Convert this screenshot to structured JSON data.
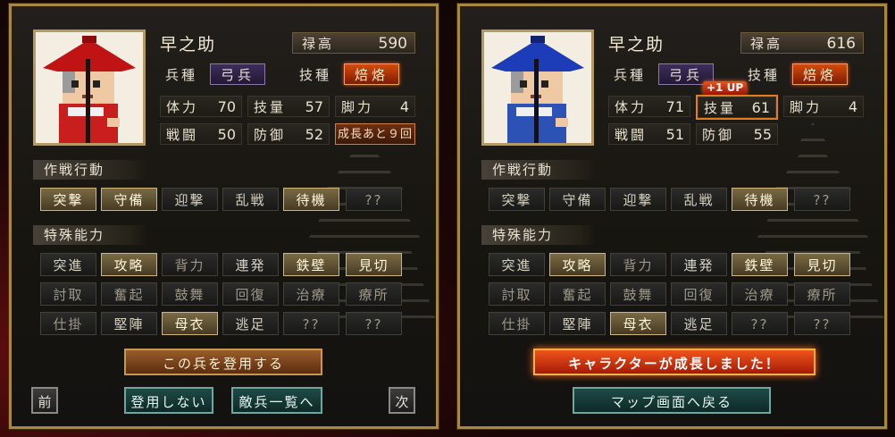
{
  "left": {
    "name": "早之助",
    "rokudaka_label": "禄高",
    "rokudaka_value": "590",
    "unit_label": "兵種",
    "unit_value": "弓兵",
    "skill_label": "技種",
    "skill_value": "焙烙",
    "stats": [
      {
        "label": "体力",
        "value": "70"
      },
      {
        "label": "技量",
        "value": "57"
      },
      {
        "label": "脚力",
        "value": "4"
      },
      {
        "label": "戦闘",
        "value": "50"
      },
      {
        "label": "防御",
        "value": "52"
      }
    ],
    "growth_text": "成長あと９回",
    "action_title": "作戦行動",
    "actions": [
      {
        "label": "突撃",
        "state": "on"
      },
      {
        "label": "守備",
        "state": "on"
      },
      {
        "label": "迎撃",
        "state": "normal"
      },
      {
        "label": "乱戦",
        "state": "normal"
      },
      {
        "label": "待機",
        "state": "on"
      },
      {
        "label": "??",
        "state": "off"
      }
    ],
    "ability_title": "特殊能力",
    "abilities": [
      {
        "label": "突進",
        "state": "normal"
      },
      {
        "label": "攻略",
        "state": "on"
      },
      {
        "label": "背力",
        "state": "off"
      },
      {
        "label": "連発",
        "state": "normal"
      },
      {
        "label": "鉄壁",
        "state": "on"
      },
      {
        "label": "見切",
        "state": "on"
      },
      {
        "label": "討取",
        "state": "off"
      },
      {
        "label": "奮起",
        "state": "off"
      },
      {
        "label": "鼓舞",
        "state": "off"
      },
      {
        "label": "回復",
        "state": "off"
      },
      {
        "label": "治療",
        "state": "off"
      },
      {
        "label": "療所",
        "state": "off"
      },
      {
        "label": "仕掛",
        "state": "off"
      },
      {
        "label": "堅陣",
        "state": "normal"
      },
      {
        "label": "母衣",
        "state": "on"
      },
      {
        "label": "逃足",
        "state": "normal"
      },
      {
        "label": "??",
        "state": "off"
      },
      {
        "label": "??",
        "state": "off"
      }
    ],
    "recruit_label": "この兵を登用する",
    "prev_label": "前",
    "decline_label": "登用しない",
    "enemy_list_label": "敵兵一覧へ",
    "next_label": "次"
  },
  "right": {
    "name": "早之助",
    "rokudaka_label": "禄高",
    "rokudaka_value": "616",
    "unit_label": "兵種",
    "unit_value": "弓兵",
    "skill_label": "技種",
    "skill_value": "焙烙",
    "stats": [
      {
        "label": "体力",
        "value": "71"
      },
      {
        "label": "技量",
        "value": "61"
      },
      {
        "label": "脚力",
        "value": "4"
      },
      {
        "label": "戦闘",
        "value": "51"
      },
      {
        "label": "防御",
        "value": "55"
      }
    ],
    "up_badge": "+1 UP",
    "action_title": "作戦行動",
    "actions": [
      {
        "label": "突撃",
        "state": "normal"
      },
      {
        "label": "守備",
        "state": "normal"
      },
      {
        "label": "迎撃",
        "state": "normal"
      },
      {
        "label": "乱戦",
        "state": "normal"
      },
      {
        "label": "待機",
        "state": "on"
      },
      {
        "label": "??",
        "state": "off"
      }
    ],
    "ability_title": "特殊能力",
    "abilities": [
      {
        "label": "突進",
        "state": "normal"
      },
      {
        "label": "攻略",
        "state": "on"
      },
      {
        "label": "背力",
        "state": "off"
      },
      {
        "label": "連発",
        "state": "normal"
      },
      {
        "label": "鉄壁",
        "state": "on"
      },
      {
        "label": "見切",
        "state": "on"
      },
      {
        "label": "討取",
        "state": "off"
      },
      {
        "label": "奮起",
        "state": "off"
      },
      {
        "label": "鼓舞",
        "state": "off"
      },
      {
        "label": "回復",
        "state": "off"
      },
      {
        "label": "治療",
        "state": "off"
      },
      {
        "label": "療所",
        "state": "off"
      },
      {
        "label": "仕掛",
        "state": "off"
      },
      {
        "label": "堅陣",
        "state": "normal"
      },
      {
        "label": "母衣",
        "state": "on"
      },
      {
        "label": "逃足",
        "state": "normal"
      },
      {
        "label": "??",
        "state": "off"
      },
      {
        "label": "??",
        "state": "off"
      }
    ],
    "growth_message": "キャラクターが成長しました！",
    "back_label": "マップ画面へ戻る"
  },
  "colors": {
    "accent_gold": "#a8873e",
    "highlight_orange": "#e17c22",
    "red_banner": "#d9330f"
  }
}
